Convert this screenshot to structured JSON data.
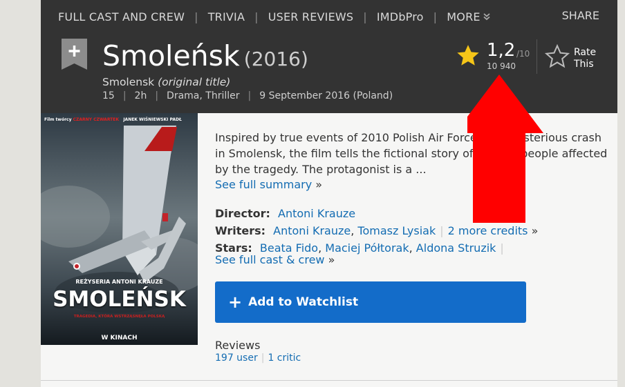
{
  "subnav": {
    "items": [
      "FULL CAST AND CREW",
      "TRIVIA",
      "USER REVIEWS",
      "IMDbPro",
      "MORE"
    ],
    "share": "SHARE"
  },
  "movie": {
    "title": "Smoleńsk",
    "year": "(2016)",
    "original_title": "Smolensk",
    "original_title_note": "(original title)",
    "certificate": "15",
    "runtime": "2h",
    "genres": "Drama, Thriller",
    "release": "9 September 2016 (Poland)"
  },
  "rating": {
    "value": "1,2",
    "max": "/10",
    "count": "10 940",
    "rate_line1": "Rate",
    "rate_line2": "This",
    "star_color": "#f5c518"
  },
  "poster": {
    "top_text_1": "Film twórcy",
    "top_text_red": "CZARNY CZWARTEK",
    "top_text_2": "JANEK WIŚNIEWSKI PADŁ",
    "director": "REŻYSERIA ANTONI KRAUZE",
    "title": "SMOLEŃSK",
    "subtitle": "TRAGEDIA, KTÓRA WSTRZĄSNĘŁA POLSKĄ",
    "release": "W KINACH"
  },
  "summary": {
    "text": "Inspired by true events of 2010 Polish Air Force One mysterious crash in Smolensk, the film tells the fictional story of various people affected by the tragedy. The protagonist is a ...",
    "see_full": "See full summary"
  },
  "credits": {
    "director_label": "Director:",
    "director": "Antoni Krauze",
    "writers_label": "Writers:",
    "writer1": "Antoni Krauze",
    "writer2": "Tomasz Lysiak",
    "writers_more": "2 more credits",
    "stars_label": "Stars:",
    "star1": "Beata Fido",
    "star2": "Maciej Półtorak",
    "star3": "Aldona Struzik",
    "see_cast": "See full cast & crew"
  },
  "watchlist": {
    "label": "Add to Watchlist",
    "color": "#136cc9"
  },
  "reviews": {
    "heading": "Reviews",
    "user": "197 user",
    "critic": "1 critic"
  },
  "annotation": {
    "arrow_color": "#ff0000"
  }
}
